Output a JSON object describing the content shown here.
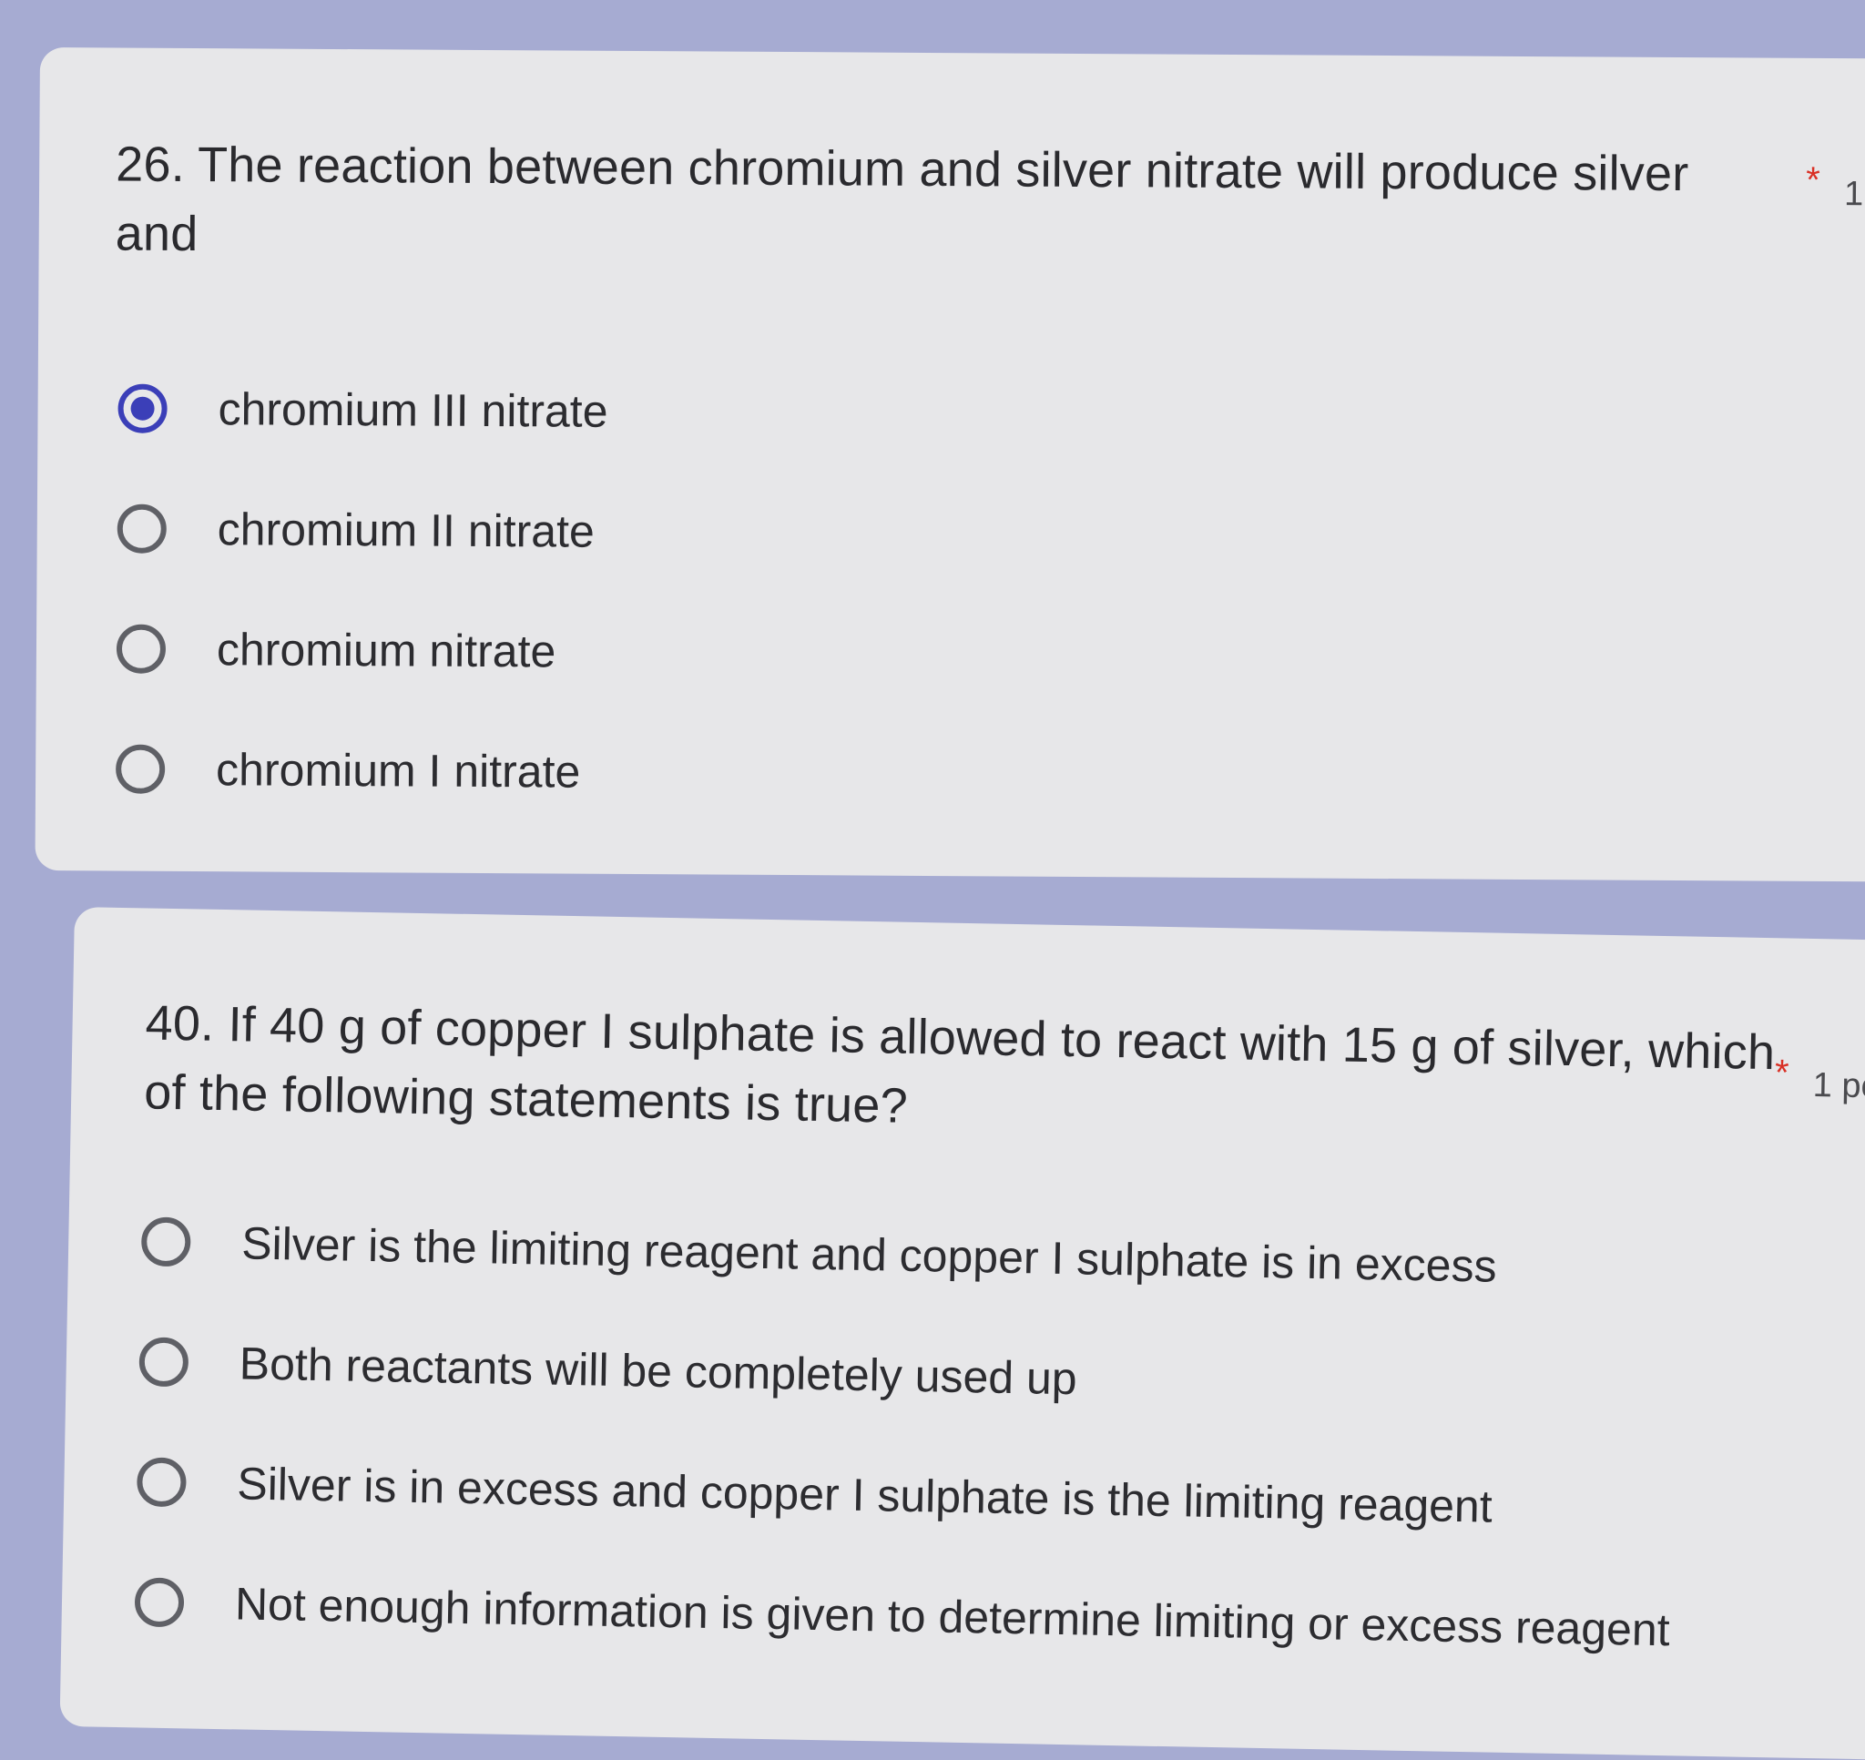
{
  "q26": {
    "text": "26. The reaction between chromium and silver nitrate will produce silver and",
    "required_mark": "*",
    "points": "1",
    "options": [
      {
        "label": "chromium III nitrate",
        "selected": true
      },
      {
        "label": "chromium II nitrate",
        "selected": false
      },
      {
        "label": "chromium nitrate",
        "selected": false
      },
      {
        "label": "chromium I nitrate",
        "selected": false
      }
    ]
  },
  "q40": {
    "text": "40. If 40 g of copper I sulphate is allowed to react with 15 g of silver, which of the following statements is true?",
    "required_mark": "*",
    "points": "1 po",
    "options": [
      {
        "label": "Silver is the limiting reagent and copper I sulphate is in excess",
        "selected": false
      },
      {
        "label": "Both reactants will be completely used up",
        "selected": false
      },
      {
        "label": "Silver is in excess and copper I sulphate is the limiting reagent",
        "selected": false
      },
      {
        "label": "Not enough information is given to determine limiting or excess reagent",
        "selected": false
      }
    ]
  },
  "colors": {
    "page_background": "#a6abd2",
    "card_background": "#e7e7e9",
    "radio_selected": "#3b3fb8",
    "radio_unselected": "#5f6066",
    "required": "#d93025"
  }
}
